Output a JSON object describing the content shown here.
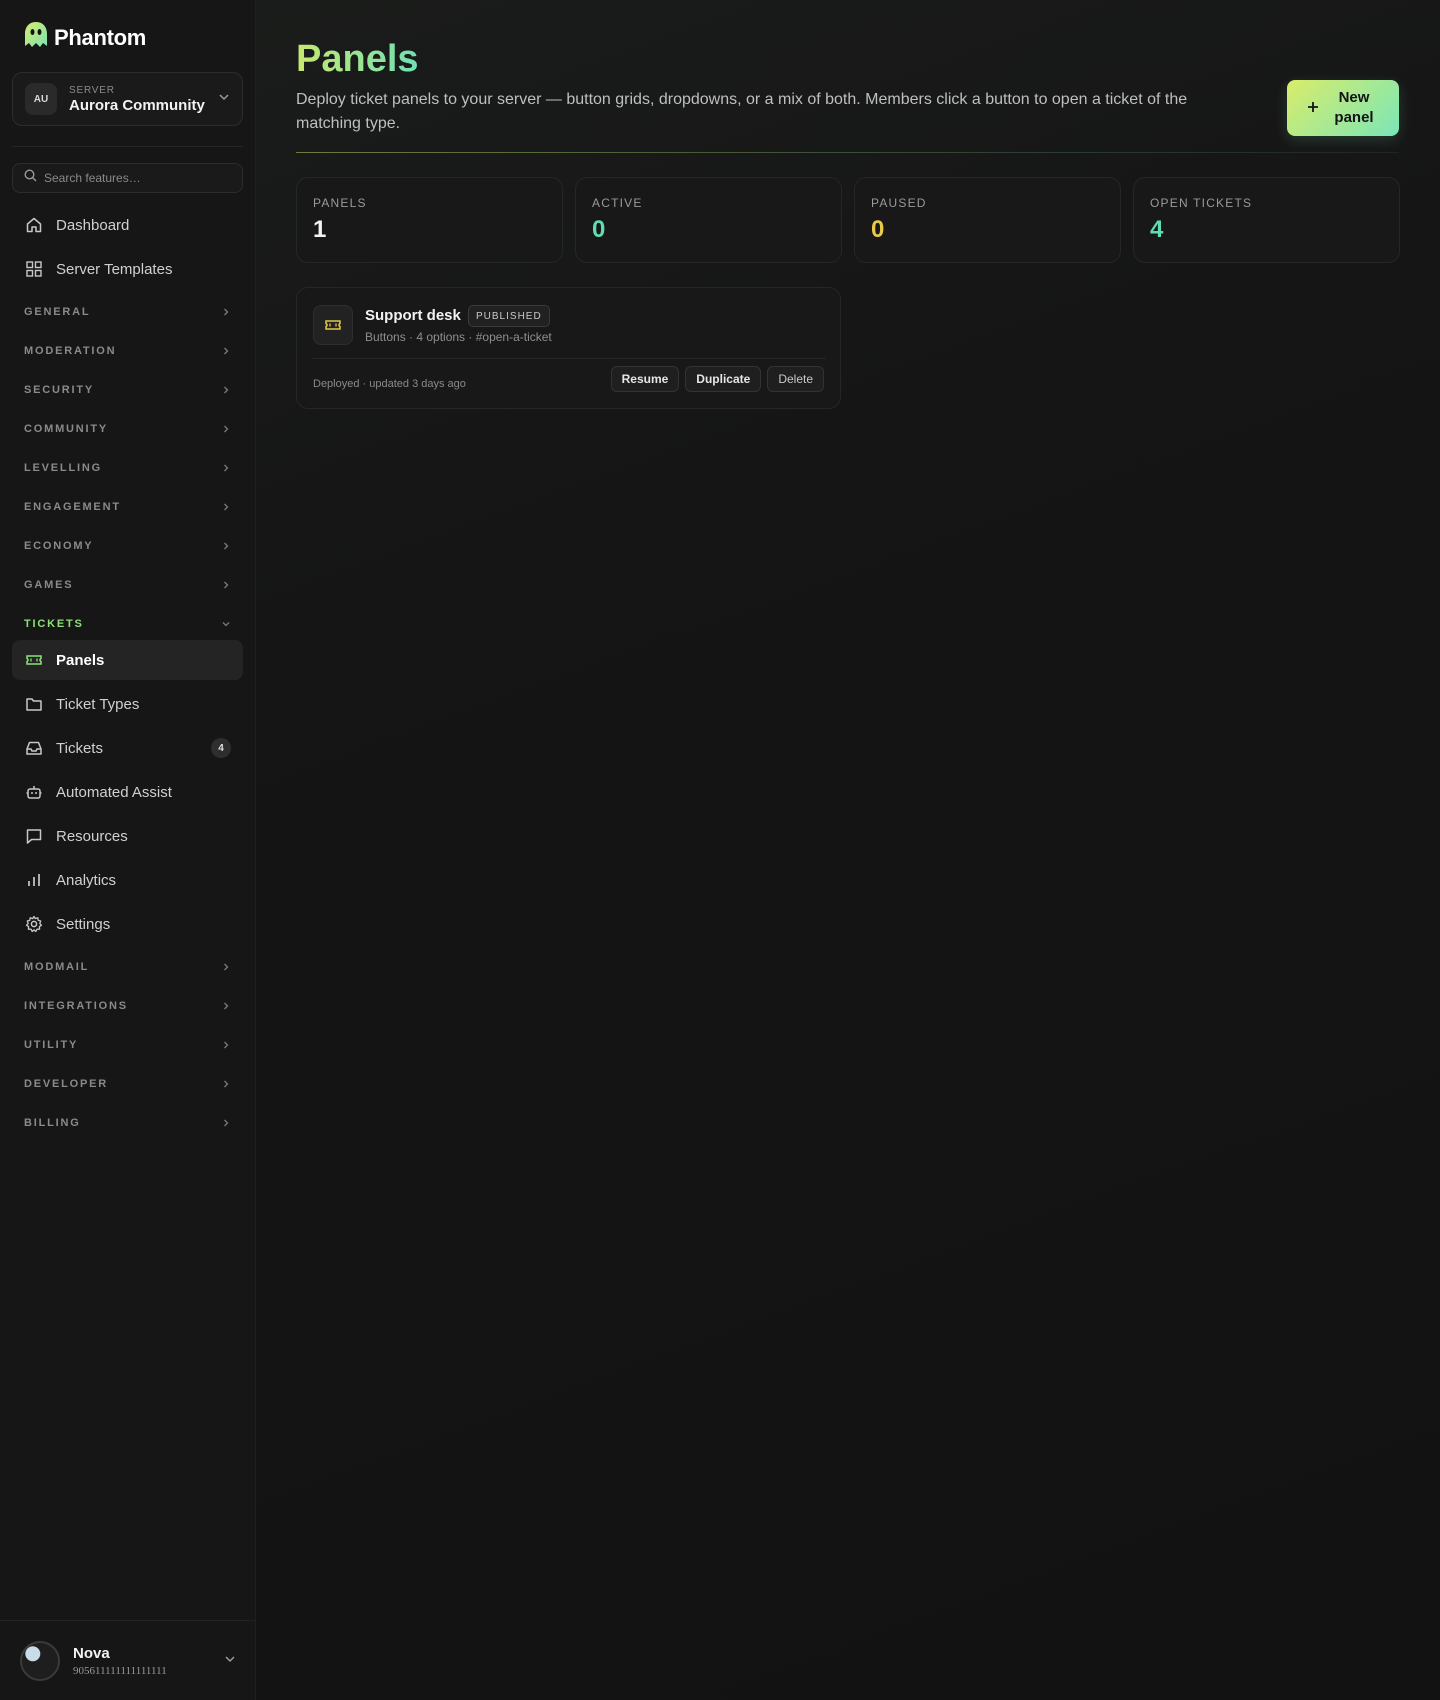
{
  "brand": {
    "name": "Phantom"
  },
  "server": {
    "label": "SERVER",
    "initials": "AU",
    "name": "Aurora Community"
  },
  "search": {
    "placeholder": "Search features…"
  },
  "nav_top": [
    {
      "label": "Dashboard",
      "icon": "home-icon"
    },
    {
      "label": "Server Templates",
      "icon": "grid-icon"
    }
  ],
  "sections_top": [
    "GENERAL",
    "MODERATION",
    "SECURITY",
    "COMMUNITY",
    "LEVELLING",
    "ENGAGEMENT",
    "ECONOMY",
    "GAMES"
  ],
  "tickets_section": {
    "label": "TICKETS",
    "items": [
      {
        "label": "Panels",
        "icon": "ticket-icon",
        "active": true
      },
      {
        "label": "Ticket Types",
        "icon": "folder-icon"
      },
      {
        "label": "Tickets",
        "icon": "inbox-icon",
        "badge": "4"
      },
      {
        "label": "Automated Assist",
        "icon": "robot-icon"
      },
      {
        "label": "Resources",
        "icon": "chat-icon"
      },
      {
        "label": "Analytics",
        "icon": "bar-chart-icon"
      },
      {
        "label": "Settings",
        "icon": "gear-icon"
      }
    ]
  },
  "sections_bottom": [
    "MODMAIL",
    "INTEGRATIONS",
    "UTILITY",
    "DEVELOPER",
    "BILLING"
  ],
  "user": {
    "name": "Nova",
    "id": "905611111111111111"
  },
  "page": {
    "title": "Panels",
    "description": "Deploy ticket panels to your server — button grids, dropdowns, or a mix of both. Members click a button to open a ticket of the matching type.",
    "new_button": "New panel"
  },
  "stats": [
    {
      "label": "PANELS",
      "value": "1",
      "color": "#f2f2f2"
    },
    {
      "label": "ACTIVE",
      "value": "0",
      "color": "#5fdcb4"
    },
    {
      "label": "PAUSED",
      "value": "0",
      "color": "#e8c94a"
    },
    {
      "label": "OPEN TICKETS",
      "value": "4",
      "color": "#5fdcb4"
    }
  ],
  "panels": [
    {
      "title": "Support desk",
      "status": "PUBLISHED",
      "meta": "Buttons · 4 options · #open-a-ticket",
      "footer": "Deployed · updated 3 days ago",
      "actions": [
        "Resume",
        "Duplicate",
        "Delete"
      ]
    }
  ],
  "colors": {
    "accent_green": "#8de07a",
    "accent_teal": "#5fdcb4",
    "accent_yellow": "#e8c94a"
  }
}
